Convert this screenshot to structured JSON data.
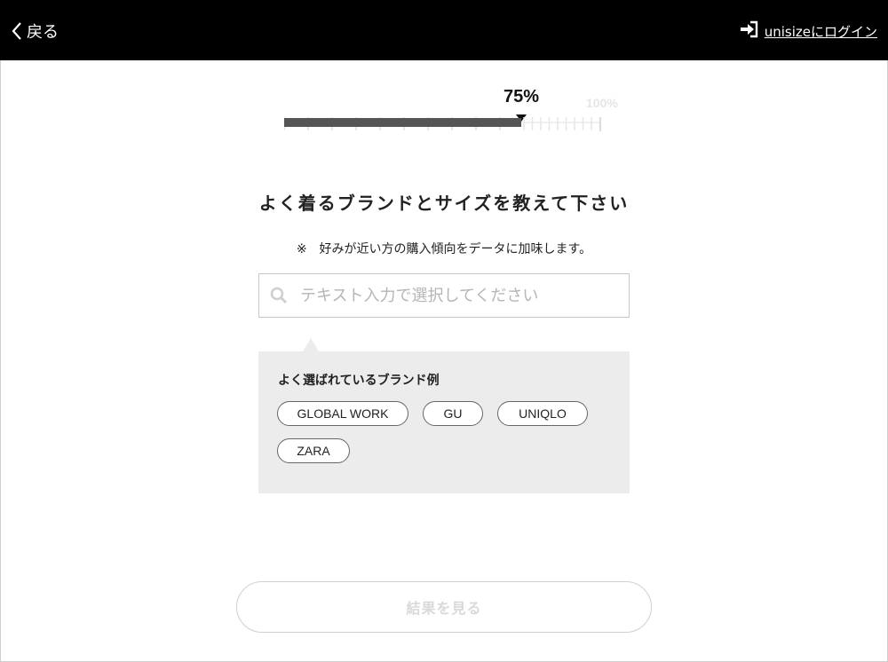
{
  "header": {
    "back_label": "戻る",
    "back_icon": "chevron-left-icon",
    "login_label": "unisizeにログイン",
    "login_icon": "sign-in-icon"
  },
  "progress": {
    "percent_label": "75%",
    "value": 0.75,
    "end_label": "100%"
  },
  "main": {
    "heading": "よく着るブランドとサイズを教えて下さい",
    "note": "※　好みが近い方の購入傾向をデータに加味します。"
  },
  "search": {
    "placeholder": "テキスト入力で選択してください",
    "value": "",
    "icon": "search-icon"
  },
  "suggestions": {
    "title": "よく選ばれているブランド例",
    "brands": [
      "GLOBAL WORK",
      "GU",
      "UNIQLO",
      "ZARA"
    ]
  },
  "footer": {
    "result_button_label": "結果を見る"
  },
  "colors": {
    "header_bg": "#000000",
    "progress_fill": "#555555",
    "panel_bg": "#ececec",
    "disabled_text": "#d9d9d9"
  }
}
